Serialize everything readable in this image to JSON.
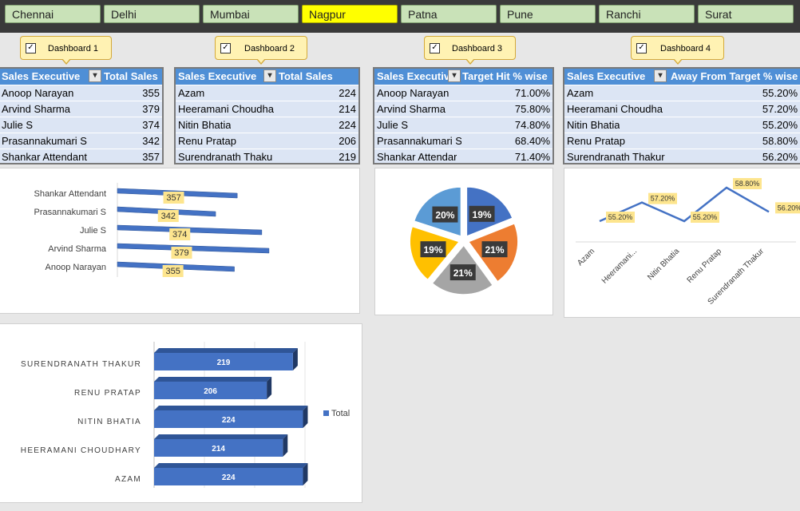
{
  "cities": [
    "Chennai",
    "Delhi",
    "Mumbai",
    "Nagpur",
    "Patna",
    "Pune",
    "Ranchi",
    "Surat"
  ],
  "active_city": "Nagpur",
  "colors": {
    "accent": "#ffff00",
    "header": "#4f8fd6",
    "bar": "#4472c4",
    "tile": "#c9e2b8"
  },
  "dashboards": [
    {
      "label": "Dashboard 1",
      "checked": true
    },
    {
      "label": "Dashboard 2",
      "checked": true
    },
    {
      "label": "Dashboard 3",
      "checked": true
    },
    {
      "label": "Dashboard 4",
      "checked": true
    }
  ],
  "tables": [
    {
      "col1": "Sales Executive",
      "col2": "Total Sales",
      "rows": [
        [
          "Anoop Narayan",
          "355"
        ],
        [
          "Arvind Sharma",
          "379"
        ],
        [
          "Julie S",
          "374"
        ],
        [
          "Prasannakumari S",
          "342"
        ],
        [
          "Shankar Attendant",
          "357"
        ]
      ]
    },
    {
      "col1": "Sales Executive",
      "col2": "Total Sales",
      "rows": [
        [
          "Azam",
          "224"
        ],
        [
          "Heeramani Choudha",
          "214"
        ],
        [
          "Nitin Bhatia",
          "224"
        ],
        [
          "Renu Pratap",
          "206"
        ],
        [
          "Surendranath Thaku",
          "219"
        ]
      ]
    },
    {
      "col1": "Sales Executiv",
      "col2": "Target Hit % wise",
      "rows": [
        [
          "Anoop Narayan",
          "71.00%"
        ],
        [
          "Arvind Sharma",
          "75.80%"
        ],
        [
          "Julie S",
          "74.80%"
        ],
        [
          "Prasannakumari S",
          "68.40%"
        ],
        [
          "Shankar Attendar",
          "71.40%"
        ]
      ]
    },
    {
      "col1": "Sales Executive",
      "col2": "Away From Target % wise",
      "rows": [
        [
          "Azam",
          "55.20%"
        ],
        [
          "Heeramani Choudha",
          "57.20%"
        ],
        [
          "Nitin Bhatia",
          "55.20%"
        ],
        [
          "Renu Pratap",
          "58.80%"
        ],
        [
          "Surendranath Thakur",
          "56.20%"
        ]
      ]
    }
  ],
  "chart_data": [
    {
      "type": "bar",
      "orientation": "horizontal",
      "title": "",
      "categories": [
        "Shankar Attendant",
        "Prasannakumari S",
        "Julie S",
        "Arvind Sharma",
        "Anoop Narayan"
      ],
      "values": [
        357,
        342,
        374,
        379,
        355
      ],
      "labels": [
        "357",
        "342",
        "374",
        "379",
        "355"
      ]
    },
    {
      "type": "pie",
      "title": "",
      "values": [
        19,
        21,
        21,
        19,
        20
      ],
      "labels": [
        "19%",
        "21%",
        "21%",
        "19%",
        "20%"
      ],
      "colors": [
        "#4472c4",
        "#ed7d31",
        "#a5a5a5",
        "#ffc000",
        "#5b9bd5"
      ]
    },
    {
      "type": "line",
      "title": "",
      "categories": [
        "Azam",
        "Heeramani...",
        "Nitin Bhatia",
        "Renu Pratap",
        "Surendranath Thakur"
      ],
      "values": [
        55.2,
        57.2,
        55.2,
        58.8,
        56.2
      ],
      "labels": [
        "55.20%",
        "57.20%",
        "55.20%",
        "58.80%",
        "56.20%"
      ]
    },
    {
      "type": "bar",
      "orientation": "horizontal",
      "title": "",
      "categories": [
        "SURENDRANATH THAKUR",
        "RENU PRATAP",
        "NITIN BHATIA",
        "HEERAMANI CHOUDHARY",
        "AZAM"
      ],
      "series": [
        {
          "name": "Total",
          "values": [
            219,
            206,
            224,
            214,
            224
          ]
        }
      ],
      "labels": [
        "219",
        "206",
        "224",
        "214",
        "224"
      ],
      "legend": "right"
    }
  ]
}
